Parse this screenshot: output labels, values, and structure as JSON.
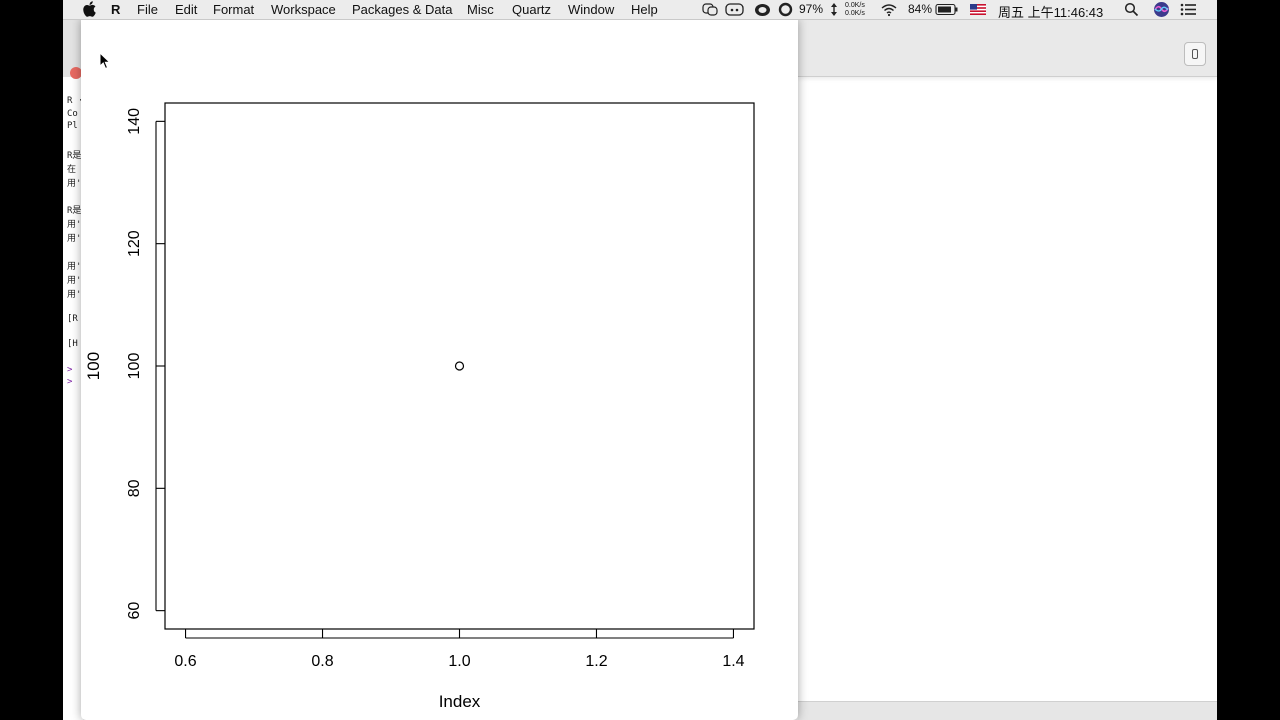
{
  "menubar": {
    "app_name": "R",
    "menus": [
      "File",
      "Edit",
      "Format",
      "Workspace",
      "Packages & Data",
      "Misc",
      "Quartz",
      "Window",
      "Help"
    ],
    "status": {
      "cpu_percent": "97%",
      "net_up": "0.0K/s",
      "net_down": "0.0K/s",
      "battery": "84%",
      "datetime": "周五 上午11:46:43"
    }
  },
  "console": {
    "lines": [
      "R ·",
      "Co",
      "Pl",
      "R是",
      "在",
      "用'",
      "R是",
      "用'",
      "用'",
      "用'",
      "用'",
      "用'",
      "[R",
      "[H",
      ">",
      ">"
    ]
  },
  "chart_data": {
    "type": "scatter",
    "x": [
      1.0
    ],
    "y": [
      100
    ],
    "xlabel": "Index",
    "ylabel": "100",
    "xlim": [
      0.57,
      1.43
    ],
    "ylim": [
      57,
      143
    ],
    "xticks": [
      0.6,
      0.8,
      1.0,
      1.2,
      1.4
    ],
    "yticks": [
      60,
      80,
      100,
      120,
      140
    ],
    "xtick_labels": [
      "0.6",
      "0.8",
      "1.0",
      "1.2",
      "1.4"
    ],
    "ytick_labels": [
      "60",
      "80",
      "100",
      "120",
      "140"
    ],
    "grid": false,
    "marker": "open-circle"
  }
}
